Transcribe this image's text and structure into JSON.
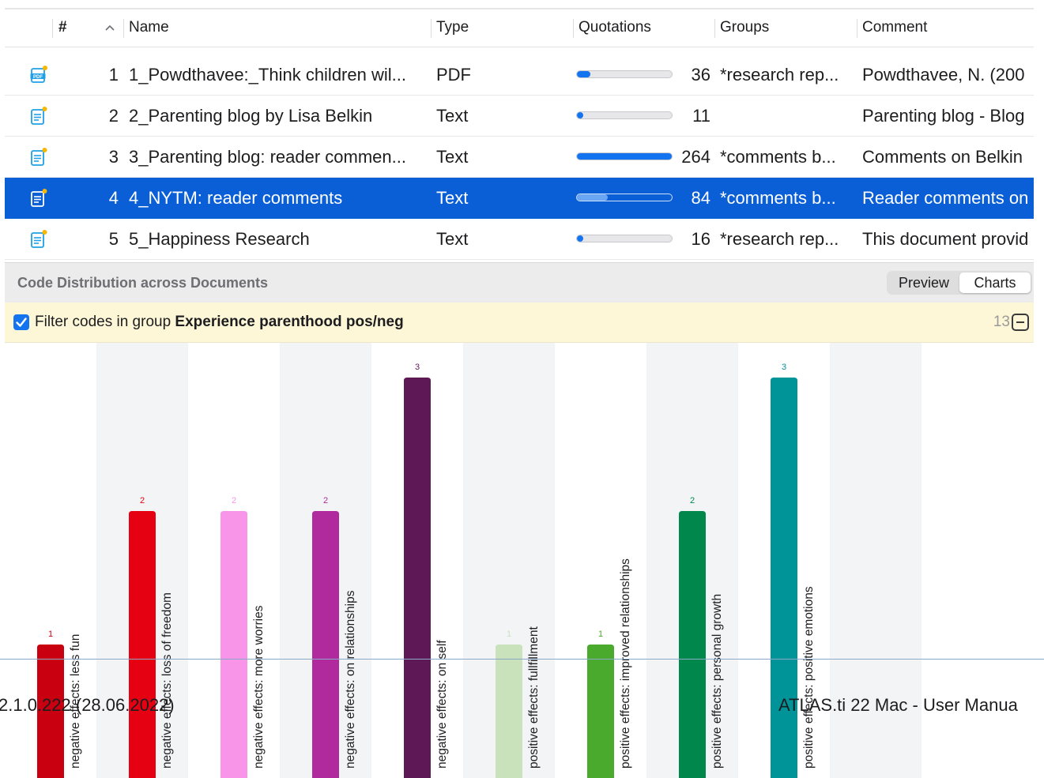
{
  "table": {
    "columns": {
      "num": "#",
      "name": "Name",
      "type": "Type",
      "quotations": "Quotations",
      "groups": "Groups",
      "comment": "Comment"
    },
    "rows": [
      {
        "index": "1",
        "name": "1_Powdthavee:_Think children wil...",
        "type": "PDF",
        "quotations": "36",
        "quotation_fraction": 0.14,
        "groups": "*research rep...",
        "comment": "Powdthavee, N. (200",
        "icon": "pdf-document-icon",
        "selected": false
      },
      {
        "index": "2",
        "name": "2_Parenting blog by Lisa Belkin",
        "type": "Text",
        "quotations": "11",
        "quotation_fraction": 0.04,
        "groups": "",
        "comment": "Parenting blog - Blog",
        "icon": "text-document-icon",
        "selected": false
      },
      {
        "index": "3",
        "name": "3_Parenting blog: reader commen...",
        "type": "Text",
        "quotations": "264",
        "quotation_fraction": 1.0,
        "groups": "*comments b...",
        "comment": "Comments on Belkin",
        "icon": "text-document-icon",
        "selected": false
      },
      {
        "index": "4",
        "name": "4_NYTM: reader comments",
        "type": "Text",
        "quotations": "84",
        "quotation_fraction": 0.32,
        "groups": "*comments b...",
        "comment": "Reader comments on",
        "icon": "text-document-icon",
        "selected": true
      },
      {
        "index": "5",
        "name": "5_Happiness Research",
        "type": "Text",
        "quotations": "16",
        "quotation_fraction": 0.06,
        "groups": "*research rep...",
        "comment": "This document provid",
        "icon": "text-document-icon",
        "selected": false
      }
    ]
  },
  "panel": {
    "title": "Code Distribution across Documents",
    "segments": [
      "Preview",
      "Charts"
    ],
    "active_segment": "Charts"
  },
  "filter": {
    "checked": true,
    "prefix": "Filter codes in group ",
    "group": "Experience parenthood pos/neg",
    "count": "13"
  },
  "chart_data": {
    "type": "bar",
    "categories": [
      "negative effects: less fun",
      "negative effects: loss of freedom",
      "negative effects: more worries",
      "negative effects: on relationships",
      "negative effects: on self",
      "positive effects: fullfillment",
      "positive effects: improved relationships",
      "positive effects: personal growth",
      "positive effects: positive emotions"
    ],
    "values": [
      1,
      2,
      2,
      2,
      3,
      1,
      1,
      2,
      3
    ],
    "colors": [
      "#c8000f",
      "#e50012",
      "#f895e8",
      "#b02a9e",
      "#5e1856",
      "#c9e2bc",
      "#4aaa2d",
      "#00874c",
      "#009499"
    ],
    "label_colors": [
      "#c8000f",
      "#e50012",
      "#f895e8",
      "#b02a9e",
      "#5e1856",
      "#c9e2bc",
      "#4aaa2d",
      "#00874c",
      "#009499"
    ],
    "grid": false,
    "title": "",
    "xlabel": "",
    "ylabel": ""
  },
  "footer": {
    "left": "2.1.0.222 (28.06.2022)",
    "right": "ATLAS.ti 22 Mac - User Manua"
  }
}
